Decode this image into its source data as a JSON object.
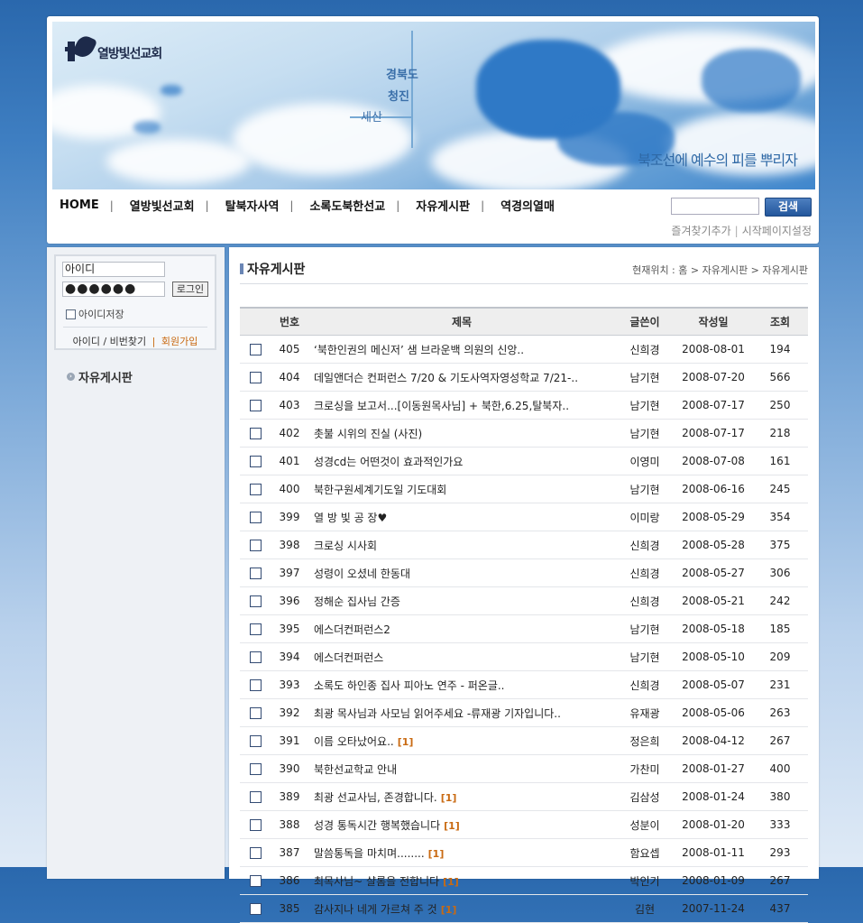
{
  "header": {
    "logo_text": "열방빛선교회",
    "slogan": "북조선에 예수의 피를 뿌리자",
    "map_labels": [
      "경북도",
      "청진",
      "세산"
    ],
    "nav": [
      "HOME",
      "열방빛선교회",
      "탈북자사역",
      "소록도북한선교",
      "자유게시판",
      "역경의열매"
    ],
    "search_placeholder": "",
    "search_button": "검색",
    "util_links": [
      "즐겨찾기추가",
      "시작페이지설정"
    ]
  },
  "login": {
    "id_value": "아이디",
    "pw_value": "●●●●●●",
    "login_button": "로그인",
    "save_id_label": "아이디저장",
    "find_link": "아이디 / 비번찾기",
    "join_link": "회원가입"
  },
  "left_menu": {
    "item": "자유게시판"
  },
  "board": {
    "title": "자유게시판",
    "breadcrumb": "현재위치 : 홈 > 자유게시판 > 자유게시판",
    "columns": [
      "번호",
      "제목",
      "글쓴이",
      "작성일",
      "조회"
    ],
    "rows": [
      {
        "no": "405",
        "subject": "‘북한인권의 메신저’ 샘 브라운백 의원의 신앙..",
        "comments": "",
        "author": "신희경",
        "date": "2008-08-01",
        "views": "194"
      },
      {
        "no": "404",
        "subject": "데일앤더슨 컨퍼런스 7/20 & 기도사역자영성학교 7/21-..",
        "comments": "",
        "author": "남기현",
        "date": "2008-07-20",
        "views": "566"
      },
      {
        "no": "403",
        "subject": "크로싱을 보고서...[이동원목사님] + 북한,6.25,탈북자..",
        "comments": "",
        "author": "남기현",
        "date": "2008-07-17",
        "views": "250"
      },
      {
        "no": "402",
        "subject": "촛불 시위의 진실 (사진)",
        "comments": "",
        "author": "남기현",
        "date": "2008-07-17",
        "views": "218"
      },
      {
        "no": "401",
        "subject": "성경cd는 어떤것이 효과적인가요",
        "comments": "",
        "author": "이영미",
        "date": "2008-07-08",
        "views": "161"
      },
      {
        "no": "400",
        "subject": "북한구원세계기도일 기도대회",
        "comments": "",
        "author": "남기현",
        "date": "2008-06-16",
        "views": "245"
      },
      {
        "no": "399",
        "subject": "열 방 빛 공 장♥",
        "comments": "",
        "author": "이미랑",
        "date": "2008-05-29",
        "views": "354"
      },
      {
        "no": "398",
        "subject": "크로싱 시사회",
        "comments": "",
        "author": "신희경",
        "date": "2008-05-28",
        "views": "375"
      },
      {
        "no": "397",
        "subject": "성령이 오셨네 한동대",
        "comments": "",
        "author": "신희경",
        "date": "2008-05-27",
        "views": "306"
      },
      {
        "no": "396",
        "subject": "정해순 집사님 간증",
        "comments": "",
        "author": "신희경",
        "date": "2008-05-21",
        "views": "242"
      },
      {
        "no": "395",
        "subject": "에스더컨퍼런스2",
        "comments": "",
        "author": "남기현",
        "date": "2008-05-18",
        "views": "185"
      },
      {
        "no": "394",
        "subject": "에스더컨퍼런스",
        "comments": "",
        "author": "남기현",
        "date": "2008-05-10",
        "views": "209"
      },
      {
        "no": "393",
        "subject": "소록도 하인종 집사 피아노 연주 - 퍼온글..",
        "comments": "",
        "author": "신희경",
        "date": "2008-05-07",
        "views": "231"
      },
      {
        "no": "392",
        "subject": "최광 목사님과 사모님 읽어주세요 -류재광 기자입니다..",
        "comments": "",
        "author": "유재광",
        "date": "2008-05-06",
        "views": "263"
      },
      {
        "no": "391",
        "subject": "이름 오타났어요..",
        "comments": "[1]",
        "author": "정은희",
        "date": "2008-04-12",
        "views": "267"
      },
      {
        "no": "390",
        "subject": "북한선교학교 안내",
        "comments": "",
        "author": "가찬미",
        "date": "2008-01-27",
        "views": "400"
      },
      {
        "no": "389",
        "subject": "최광 선교사님, 존경합니다.",
        "comments": "[1]",
        "author": "김삼성",
        "date": "2008-01-24",
        "views": "380"
      },
      {
        "no": "388",
        "subject": "성경 통독시간 행복했습니다",
        "comments": "[1]",
        "author": "성분이",
        "date": "2008-01-20",
        "views": "333"
      },
      {
        "no": "387",
        "subject": "말씀통독을 마치며........",
        "comments": "[1]",
        "author": "함요셉",
        "date": "2008-01-11",
        "views": "293"
      },
      {
        "no": "386",
        "subject": "최목사님~ 샬롬을 전합니다",
        "comments": "[1]",
        "author": "박인기",
        "date": "2008-01-09",
        "views": "267"
      },
      {
        "no": "385",
        "subject": "감사지나 네게 가르쳐 주 것",
        "comments": "[1]",
        "author": "김현",
        "date": "2007-11-24",
        "views": "437"
      }
    ]
  }
}
